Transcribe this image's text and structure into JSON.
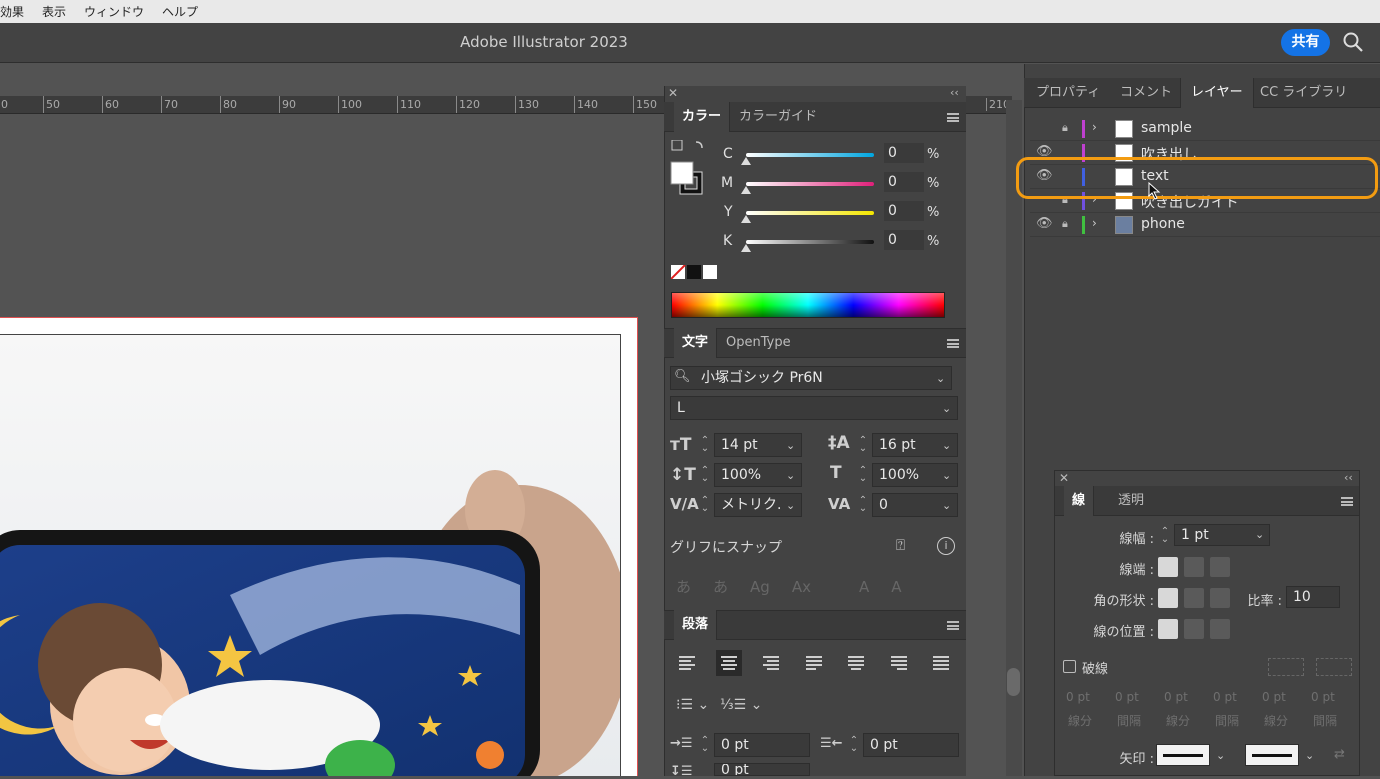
{
  "menubar": {
    "items": [
      "効果",
      "表示",
      "ウィンドウ",
      "ヘルプ"
    ]
  },
  "titlebar": {
    "title": "Adobe Illustrator 2023",
    "share_label": "共有"
  },
  "ruler": {
    "ticks": [
      "0",
      "50",
      "60",
      "70",
      "80",
      "90",
      "100",
      "110",
      "120",
      "130",
      "140",
      "150"
    ],
    "right_tick": "210"
  },
  "color_panel": {
    "tabs": [
      "カラー",
      "カラーガイド"
    ],
    "channels": [
      {
        "label": "C",
        "value": "0",
        "unit": "%"
      },
      {
        "label": "M",
        "value": "0",
        "unit": "%"
      },
      {
        "label": "Y",
        "value": "0",
        "unit": "%"
      },
      {
        "label": "K",
        "value": "0",
        "unit": "%"
      }
    ]
  },
  "char_panel": {
    "tabs": [
      "文字",
      "OpenType"
    ],
    "font_family": "小塚ゴシック Pr6N",
    "font_style": "L",
    "font_size": "14 pt",
    "leading": "16 pt",
    "vertical_scale": "100%",
    "horizontal_scale": "100%",
    "kerning": "メトリク.",
    "tracking": "0",
    "snap_label": "グリフにスナップ"
  },
  "para_panel": {
    "tab": "段落",
    "indent_left": "0 pt",
    "indent_right": "0 pt",
    "space_before": "0 pt"
  },
  "right_panel": {
    "tabs": [
      "プロパティ",
      "コメント",
      "レイヤー",
      "CC ライブラリ"
    ],
    "layers": [
      {
        "name": "sample",
        "color": "#c040d0",
        "visible": false,
        "locked": true,
        "expandable": true
      },
      {
        "name": "吹き出し",
        "color": "#c040d0",
        "visible": true,
        "locked": false,
        "expandable": false
      },
      {
        "name": "text",
        "color": "#4060e0",
        "visible": true,
        "locked": false,
        "expandable": false
      },
      {
        "name": "吹き出しガイド",
        "color": "#7050e0",
        "visible": false,
        "locked": true,
        "expandable": true
      },
      {
        "name": "phone",
        "color": "#40c040",
        "visible": true,
        "locked": true,
        "expandable": true
      }
    ]
  },
  "stroke_panel": {
    "tabs": [
      "線",
      "透明"
    ],
    "weight_label": "線幅 :",
    "weight_value": "1 pt",
    "cap_label": "線端 :",
    "corner_label": "角の形状 :",
    "limit_label": "比率 :",
    "limit_value": "10",
    "align_label": "線の位置 :",
    "dashed_label": "破線",
    "dash_values": [
      "0 pt",
      "0 pt",
      "0 pt",
      "0 pt",
      "0 pt",
      "0 pt"
    ],
    "dash_labels": [
      "線分",
      "間隔",
      "線分",
      "間隔",
      "線分",
      "間隔"
    ],
    "arrow_label": "矢印 :"
  }
}
